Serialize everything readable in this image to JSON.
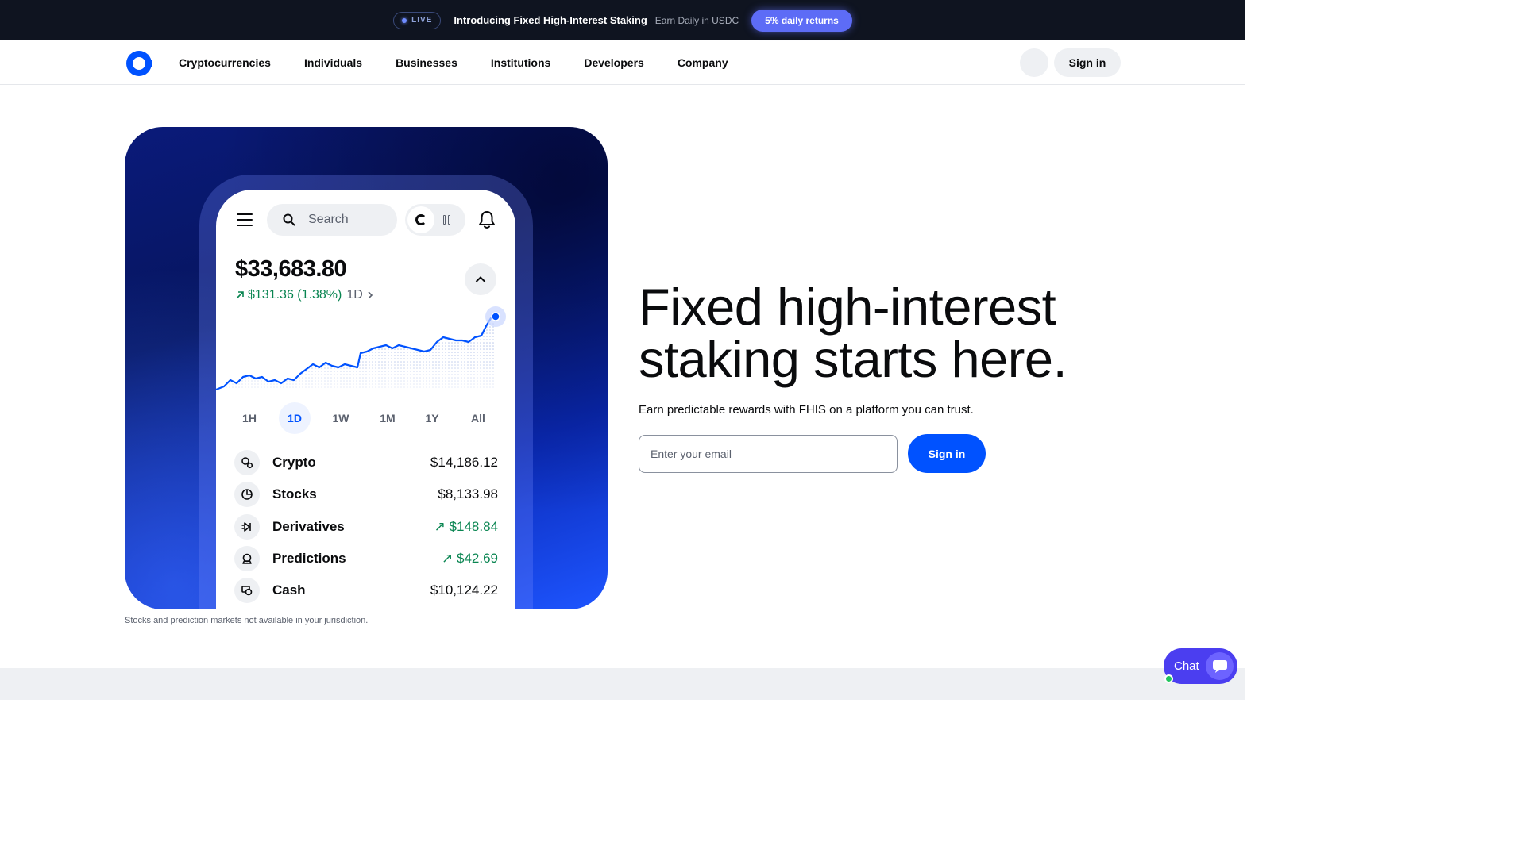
{
  "banner": {
    "live_label": "LIVE",
    "title": "Introducing Fixed High-Interest Staking",
    "subtitle": "Earn Daily in USDC",
    "cta": "5% daily returns"
  },
  "nav": {
    "links": [
      "Cryptocurrencies",
      "Individuals",
      "Businesses",
      "Institutions",
      "Developers",
      "Company"
    ],
    "icon_button_glyph": "",
    "sign_in": "Sign in"
  },
  "phone": {
    "search_placeholder": "Search",
    "balance": "$33,683.80",
    "change": "$131.36 (1.38%)",
    "change_period": "1D",
    "ranges": [
      "1H",
      "1D",
      "1W",
      "1M",
      "1Y",
      "All"
    ],
    "active_range": "1D",
    "assets": [
      {
        "name": "Crypto",
        "value": "$14,186.12",
        "positive": false,
        "icon": "crypto-icon"
      },
      {
        "name": "Stocks",
        "value": "$8,133.98",
        "positive": false,
        "icon": "stocks-icon"
      },
      {
        "name": "Derivatives",
        "value": "$148.84",
        "positive": true,
        "icon": "derivatives-icon"
      },
      {
        "name": "Predictions",
        "value": "$42.69",
        "positive": true,
        "icon": "predictions-icon"
      },
      {
        "name": "Cash",
        "value": "$10,124.22",
        "positive": false,
        "icon": "cash-icon"
      }
    ]
  },
  "disclaimer": "Stocks and prediction markets not available in your jurisdiction.",
  "hero": {
    "headline_line1": "Fixed high-interest",
    "headline_line2": "staking starts here.",
    "subhead": "Earn predictable rewards with FHIS on a platform you can trust.",
    "email_placeholder": "Enter your email",
    "sign_in": "Sign in"
  },
  "chat": {
    "label": "Chat"
  },
  "colors": {
    "brand_blue": "#0052ff",
    "positive_green": "#098551",
    "banner_bg": "#0f1420",
    "chat_purple": "#4b3ef0"
  }
}
